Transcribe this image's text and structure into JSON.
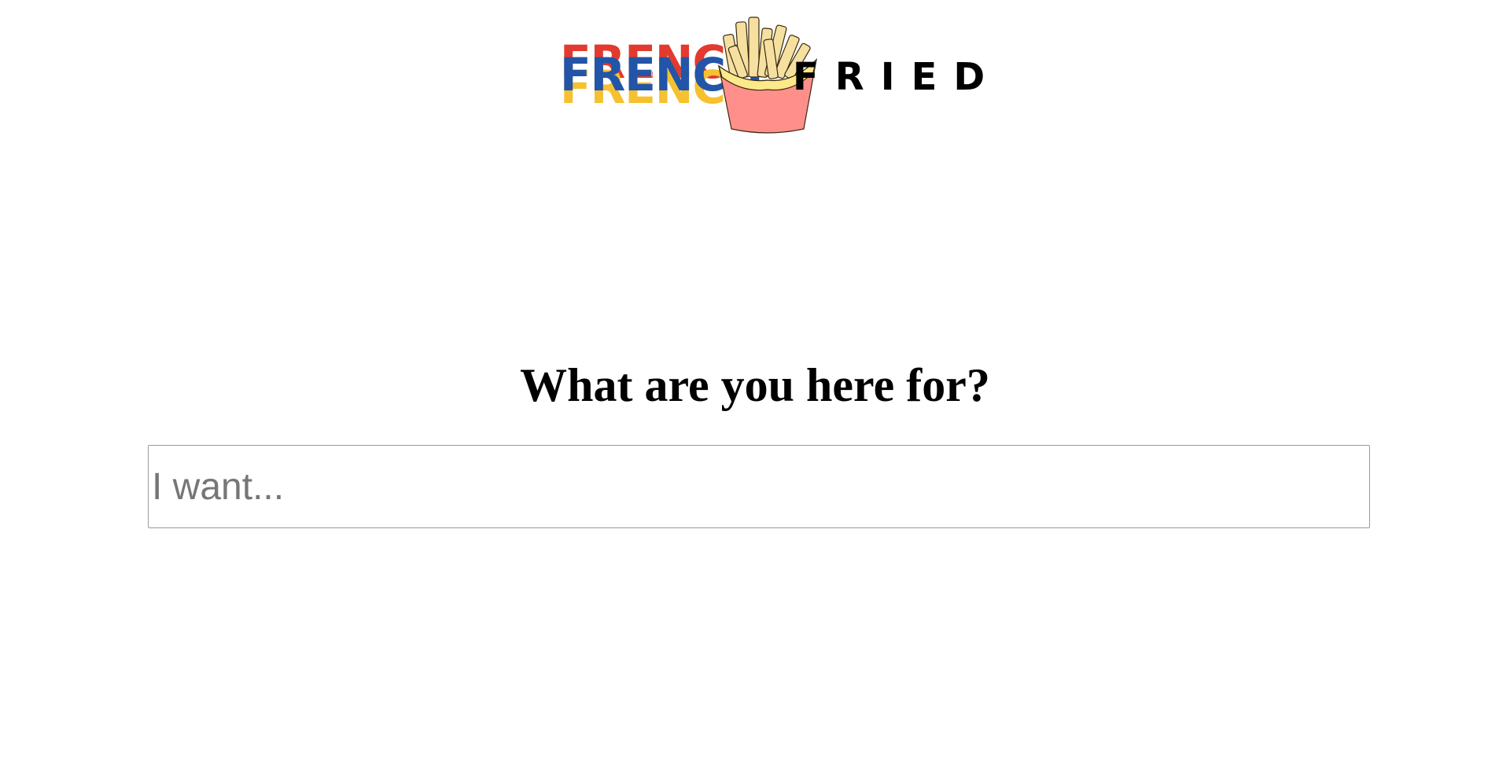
{
  "logo": {
    "word_french": "FRENCH",
    "word_fried": "FRIED",
    "icon": "french-fries-icon",
    "colors": {
      "red": "#e23a2f",
      "blue": "#2255a8",
      "yellow": "#f6c12f",
      "carton": "#ff8f8b",
      "fries": "#f6e0a0"
    }
  },
  "main": {
    "heading": "What are you here for?",
    "search": {
      "placeholder": "I want...",
      "value": ""
    }
  }
}
